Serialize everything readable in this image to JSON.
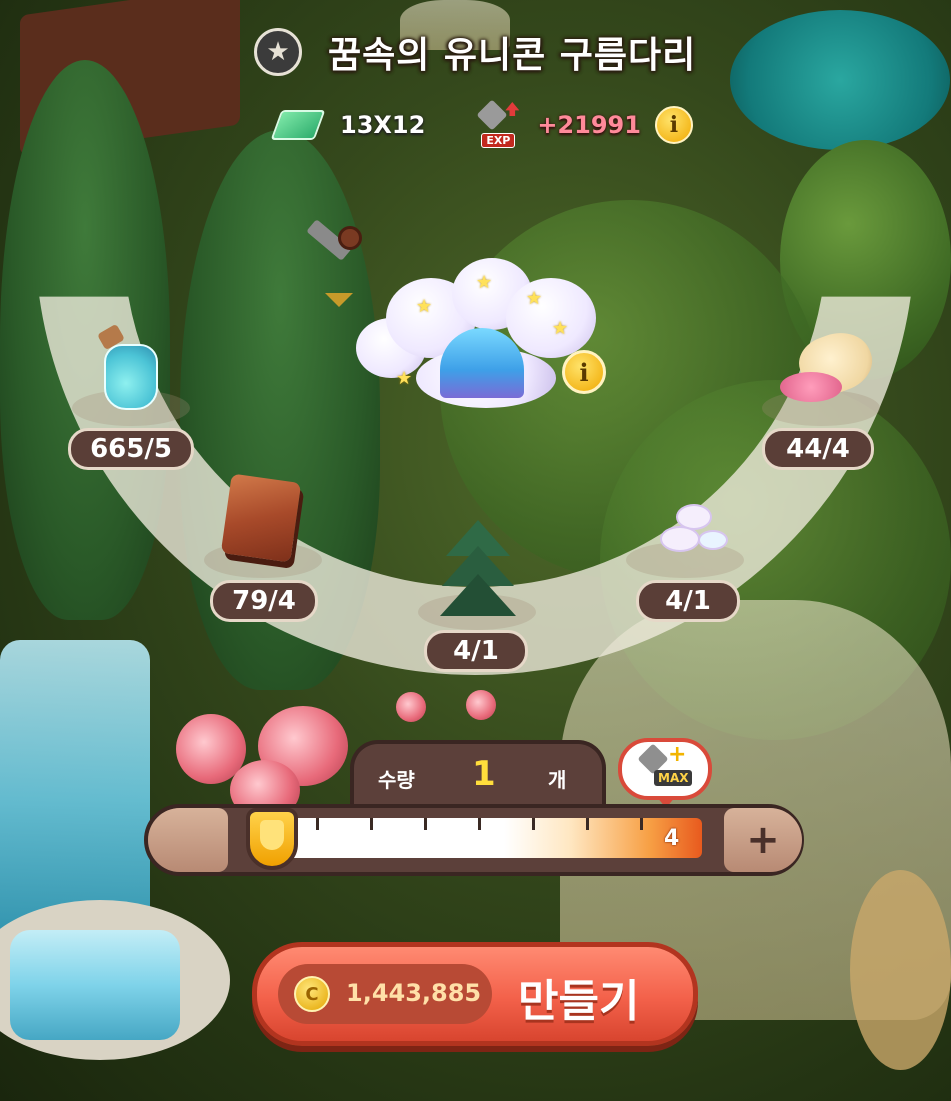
{
  "header": {
    "title": "꿈속의 유니콘 구름다리",
    "size": "13X12",
    "exp_label": "EXP",
    "exp_value": "+21991"
  },
  "product": {
    "name_icon": "cloud-bridge-icon"
  },
  "materials": [
    {
      "icon": "potion-bottle-icon",
      "count": "665/5"
    },
    {
      "icon": "wood-plank-icon",
      "count": "79/4"
    },
    {
      "icon": "pine-tree-icon",
      "count": "4/1"
    },
    {
      "icon": "cloud-cotton-icon",
      "count": "4/1"
    },
    {
      "icon": "pink-sugar-sack-icon",
      "count": "44/4"
    }
  ],
  "quantity": {
    "label": "수량",
    "value": "1",
    "unit": "개",
    "max": "4",
    "max_label": "MAX",
    "plus_label": "+"
  },
  "make": {
    "cost": "1,443,885",
    "label": "만들기"
  },
  "colors": {
    "make_button": "#f3614a",
    "panel": "#5c403a",
    "accent_yellow": "#ffde3c"
  }
}
